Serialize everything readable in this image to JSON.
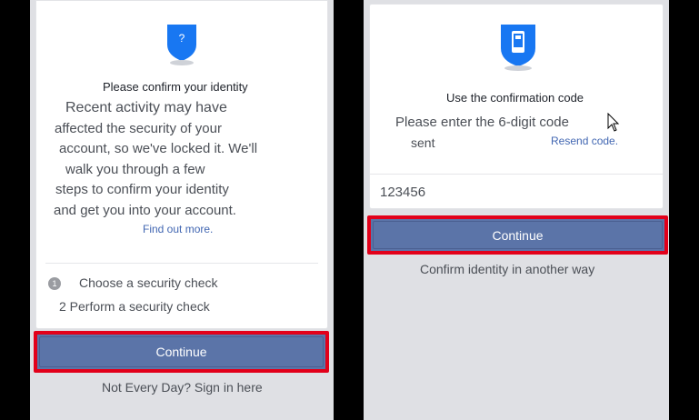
{
  "left": {
    "title": "Please confirm your identity",
    "message_lines": [
      "Recent activity may have",
      "affected the security of your",
      "account, so we've locked it. We'll",
      "walk you through a few",
      "steps to confirm your identity",
      "and get you into your account."
    ],
    "find_out_more": "Find out more.",
    "step1_number": "1",
    "step1": "Choose a security check",
    "step2": "2 Perform a security check",
    "continue": "Continue",
    "sign_in": "Not Every Day? Sign in here",
    "shield_glyph": "?"
  },
  "right": {
    "title": "Use the confirmation code",
    "message": "Please enter the 6-digit code",
    "sent": "sent",
    "resend": "Resend code.",
    "code_value": "123456",
    "continue": "Continue",
    "alt_link": "Confirm identity in another way"
  },
  "colors": {
    "accent": "#5b74a8",
    "highlight": "#e2001a",
    "shield": "#1877f2",
    "link": "#4267b2"
  }
}
